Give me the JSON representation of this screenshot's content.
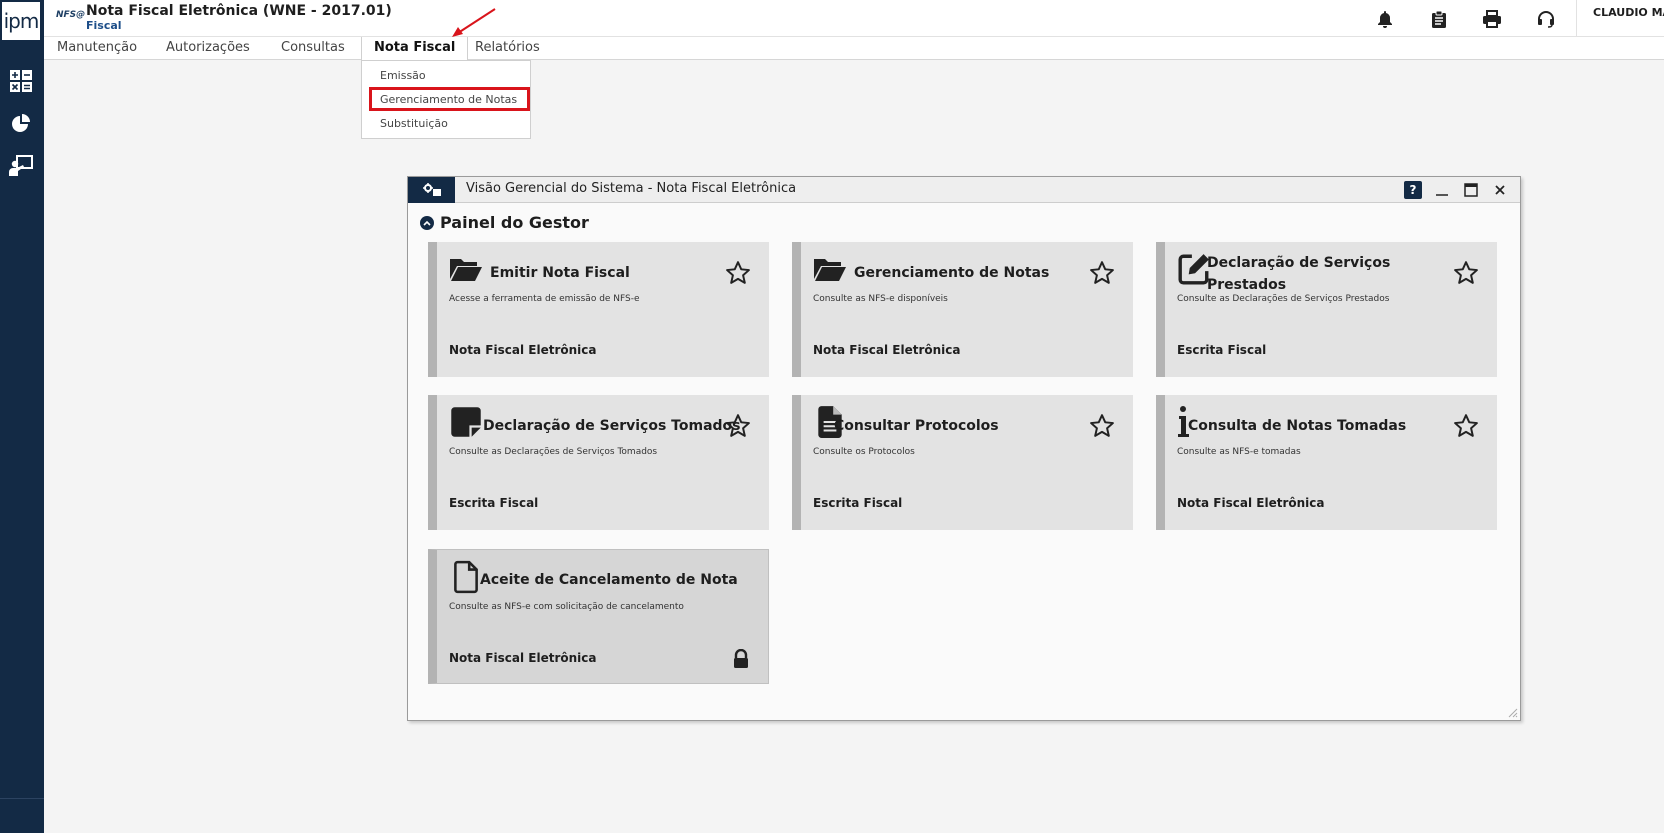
{
  "sidebar": {
    "logo_text": "ipm",
    "items": [
      {
        "icon": "calculator-icon"
      },
      {
        "icon": "pie-chart-icon"
      },
      {
        "icon": "user-presentation-icon"
      }
    ]
  },
  "header": {
    "logo_text": "NFS@",
    "title": "Nota Fiscal Eletrônica (WNE - 2017.01)",
    "subtitle": "Fiscal",
    "icons": [
      "bell-icon",
      "clipboard-icon",
      "printer-icon",
      "headset-icon"
    ],
    "user_name": "CLAUDIO MA"
  },
  "menu": {
    "items": [
      "Manutenção",
      "Autorizações",
      "Consultas",
      "Nota Fiscal",
      "Relatórios"
    ],
    "active": "Nota Fiscal",
    "dropdown": [
      "Emissão",
      "Gerenciamento de Notas",
      "Substituição"
    ],
    "highlighted": "Gerenciamento de Notas"
  },
  "window": {
    "title": "Visão Gerencial do Sistema - Nota Fiscal Eletrônica",
    "help_label": "?",
    "section_title": "Painel do Gestor",
    "cards": [
      {
        "title": "Emitir Nota Fiscal",
        "description": "Acesse a ferramenta de emissão de NFS-e",
        "category": "Nota Fiscal Eletrônica",
        "icon": "folder-open-icon"
      },
      {
        "title": "Gerenciamento de Notas",
        "description": "Consulte as NFS-e disponíveis",
        "category": "Nota Fiscal Eletrônica",
        "icon": "folder-open-icon"
      },
      {
        "title": "Declaração de Serviços Prestados",
        "description": "Consulte as Declarações de Serviços Prestados",
        "category": "Escrita Fiscal",
        "icon": "edit-icon"
      },
      {
        "title": "Declaração de Serviços Tomados",
        "description": "Consulte as Declarações de Serviços Tomados",
        "category": "Escrita Fiscal",
        "icon": "sticky-note-icon"
      },
      {
        "title": "Consultar Protocolos",
        "description": "Consulte os Protocolos",
        "category": "Escrita Fiscal",
        "icon": "file-text-icon"
      },
      {
        "title": "Consulta de Notas Tomadas",
        "description": "Consulte as NFS-e tomadas",
        "category": "Nota Fiscal Eletrônica",
        "icon": "info-icon"
      },
      {
        "title": "Aceite de Cancelamento de Nota",
        "description": "Consulte as NFS-e com solicitação de cancelamento",
        "category": "Nota Fiscal Eletrônica",
        "icon": "file-icon",
        "locked": true
      }
    ]
  },
  "colors": {
    "sidebar": "#132a45",
    "highlight_border": "#d9141b",
    "card_bg": "#e3e3e3",
    "card_border": "#b3b3b3"
  }
}
